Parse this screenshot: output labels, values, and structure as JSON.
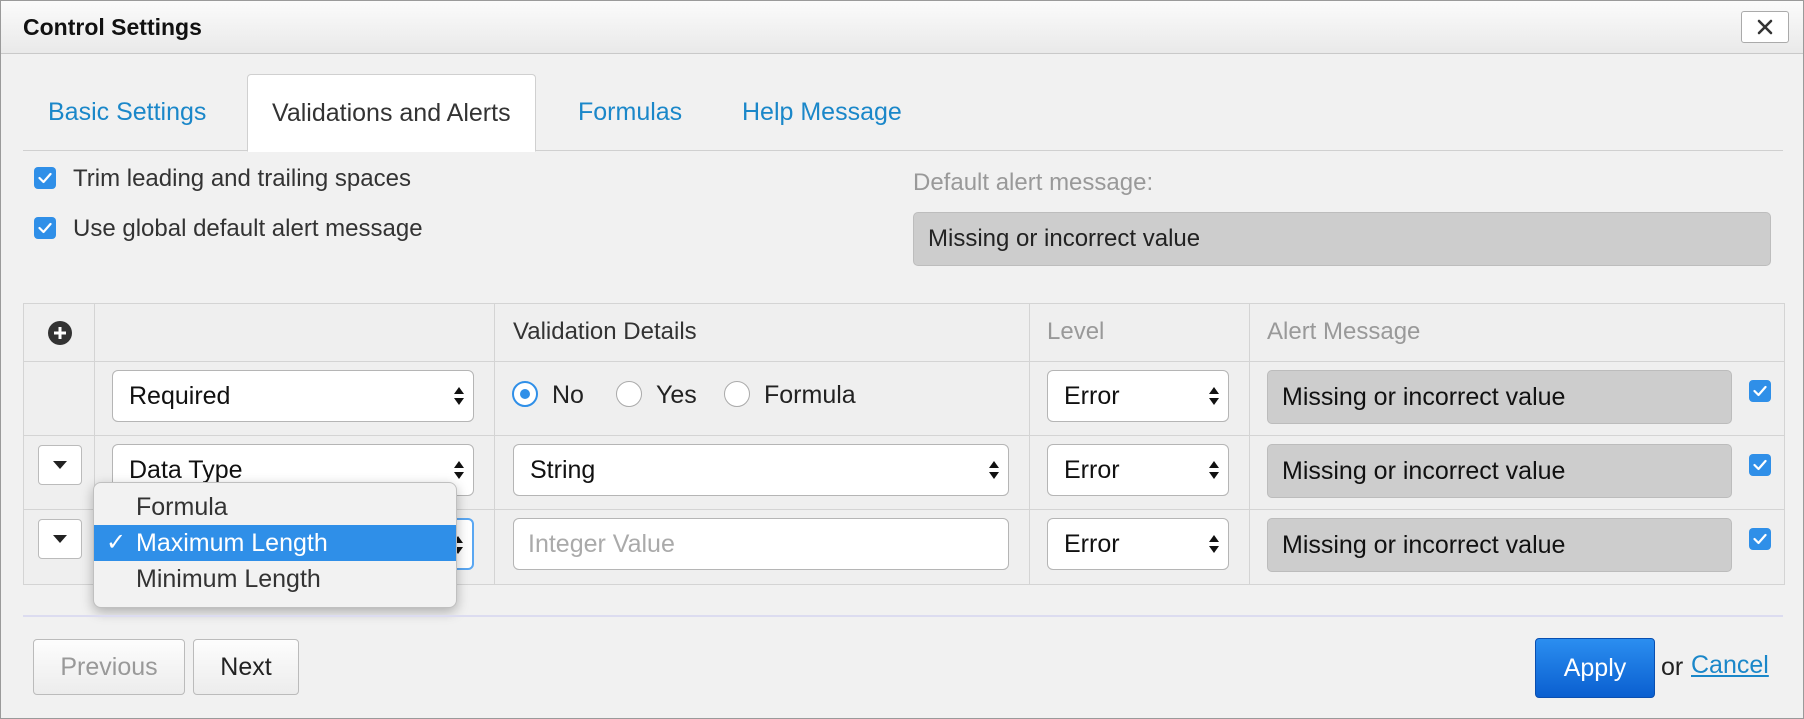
{
  "window": {
    "title": "Control Settings"
  },
  "tabs": [
    {
      "label": "Basic Settings"
    },
    {
      "label": "Validations and Alerts"
    },
    {
      "label": "Formulas"
    },
    {
      "label": "Help Message"
    }
  ],
  "options": {
    "trim_label": "Trim leading and trailing spaces",
    "global_alert_label": "Use global default alert message",
    "trim_checked": true,
    "global_alert_checked": true
  },
  "default_alert": {
    "label": "Default alert message:",
    "value": "Missing or incorrect value"
  },
  "table": {
    "headers": {
      "details": "Validation Details",
      "level": "Level",
      "alert": "Alert Message"
    },
    "rows": [
      {
        "type": "Required",
        "radios": [
          "No",
          "Yes",
          "Formula"
        ],
        "radio_selected": "No",
        "level": "Error",
        "alert": "Missing or incorrect value",
        "checked": true
      },
      {
        "type": "Data Type",
        "detail": "String",
        "level": "Error",
        "alert": "Missing or incorrect value",
        "checked": true
      },
      {
        "type": "Maximum Length",
        "detail_placeholder": "Integer Value",
        "level": "Error",
        "alert": "Missing or incorrect value",
        "checked": true
      }
    ]
  },
  "dropdown": {
    "items": [
      "Formula",
      "Maximum Length",
      "Minimum Length"
    ],
    "selected": "Maximum Length",
    "check_mark": "✓"
  },
  "footer": {
    "previous": "Previous",
    "next": "Next",
    "apply": "Apply",
    "or": "or",
    "cancel": "Cancel"
  },
  "colors": {
    "accent": "#2f8fe8",
    "link": "#1a87c9",
    "apply": "#0a5fd0"
  }
}
